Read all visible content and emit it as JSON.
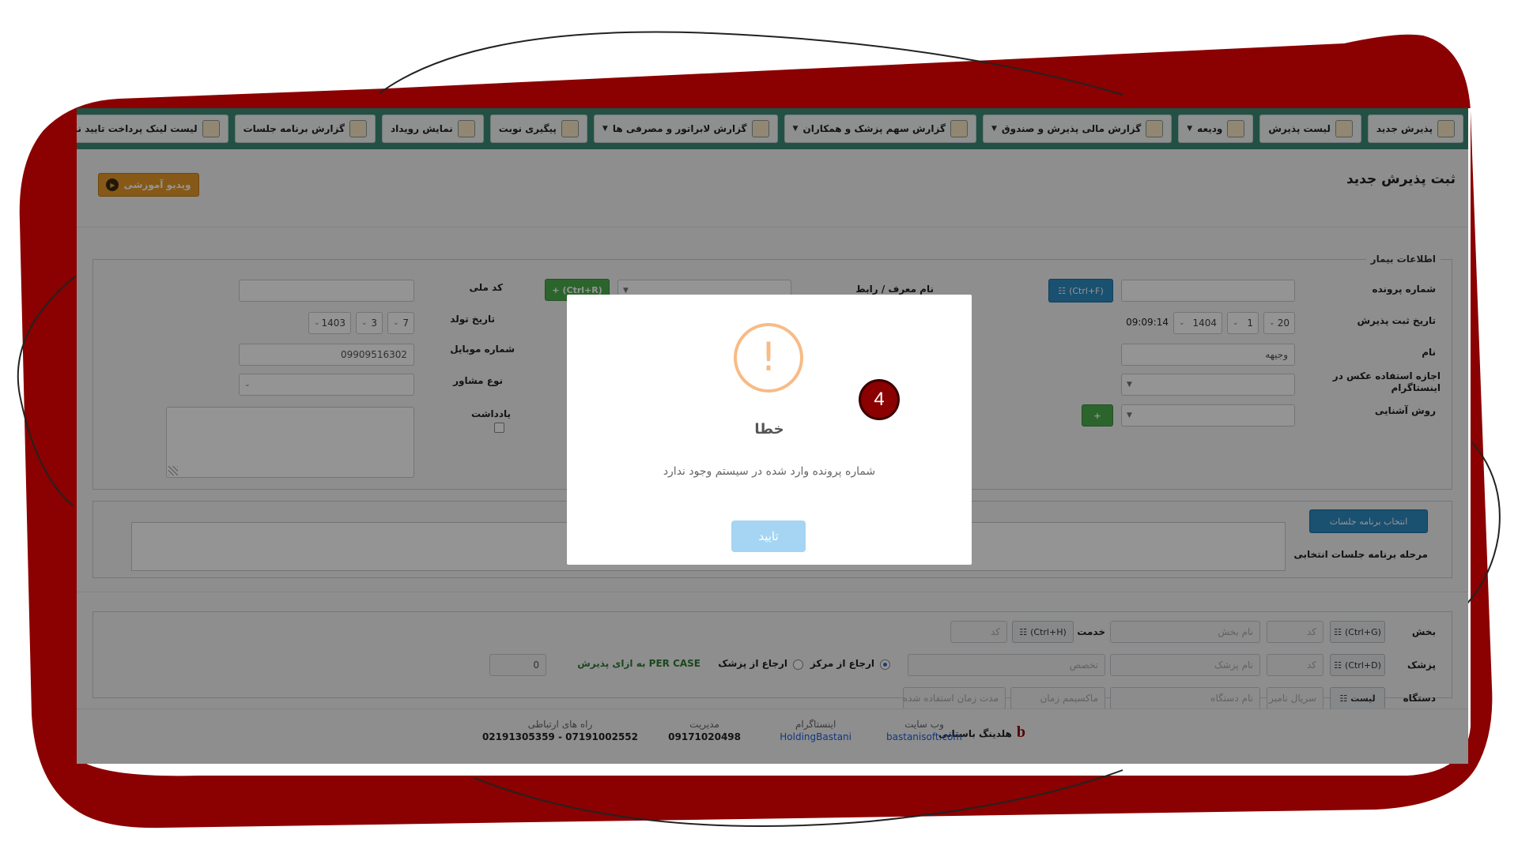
{
  "colors": {
    "frame": "#8b0000",
    "nav": "#3b8a78",
    "accent_blue": "#2d8bc1",
    "green": "#4cae4c",
    "warning": "#f8bb86",
    "confirm": "#a5d5f2"
  },
  "nav": {
    "items": [
      {
        "label": "پذیرش جدید",
        "icon": "user-add-icon",
        "dropdown": false
      },
      {
        "label": "لیست پذیرش",
        "icon": "list-doc-icon",
        "dropdown": false
      },
      {
        "label": "ودیعه",
        "icon": "deposit-icon",
        "dropdown": true
      },
      {
        "label": "گزارش مالی پذیرش و صندوق",
        "icon": "finance-report-icon",
        "dropdown": true
      },
      {
        "label": "گزارش سهم پزشک و همکاران",
        "icon": "doctor-share-icon",
        "dropdown": true
      },
      {
        "label": "گزارش لابراتور و مصرفی ها",
        "icon": "lab-report-icon",
        "dropdown": true
      },
      {
        "label": "پیگیری نوبت",
        "icon": "followup-icon",
        "dropdown": false
      },
      {
        "label": "نمایش رویداد",
        "icon": "calendar-icon",
        "dropdown": false
      },
      {
        "label": "گزارش برنامه جلسات",
        "icon": "sessions-icon",
        "dropdown": false
      },
      {
        "label": "لیست لینک پرداخت تایید نشده",
        "icon": "payment-link-icon",
        "dropdown": false
      }
    ]
  },
  "page": {
    "title": "ثبت پذیرش جدید",
    "video_button": "ویدیو آموزشی"
  },
  "patient": {
    "legend": "اطلاعات بیمار",
    "file_number_label": "شماره پرونده",
    "file_number_shortcut": "(Ctrl+F)",
    "referrer_label": "نام معرف / رابط",
    "referrer_add": "(Ctrl+R)",
    "national_code_label": "کد ملی",
    "admission_date_label": "تاریخ ثبت پذیرش",
    "admission_day": "20",
    "admission_month": "1",
    "admission_year": "1404",
    "admission_time": "09:09:14",
    "birth_date_label": "تاریخ تولد",
    "birth_day": "7",
    "birth_month": "3",
    "birth_year": "1403",
    "name_label": "نام",
    "name_value": "وجیهه",
    "mobile_label": "شماره موبایل",
    "mobile_value": "09909516302",
    "instagram_permission_label": "اجازه استفاده عکس در اینستاگرام",
    "advisor_type_label": "نوع مشاور",
    "acquaintance_label": "روش آشنایی",
    "note_label": "یادداشت"
  },
  "sessions": {
    "button": "انتخاب برنامه جلسات",
    "stage_label": "مرحله برنامه جلسات انتخابی"
  },
  "services": {
    "department_label": "بخش",
    "department_shortcut": "(Ctrl+G)",
    "code_placeholder": "کد",
    "department_name_placeholder": "نام بخش",
    "service_label": "خدمت",
    "service_shortcut": "(Ctrl+H)",
    "doctor_label": "پزشک",
    "doctor_shortcut": "(Ctrl+D)",
    "doctor_name_placeholder": "نام پزشک",
    "specialty_placeholder": "تخصص",
    "referral_center": "ارجاع از مرکز",
    "referral_doctor": "ارجاع از پزشک",
    "per_case": "PER CASE به ازای پذیرش",
    "per_case_value": "0",
    "device_label": "دستگاه",
    "device_list_button": "لیست",
    "serial_placeholder": "سریال نامبر",
    "device_name_placeholder": "نام دستگاه",
    "max_time_placeholder": "ماکسیمم زمان",
    "used_time_placeholder": "مدت زمان استفاده شده"
  },
  "footer": {
    "brand": "هلدینگ باستانی",
    "website_label": "وب سایت",
    "website_value": "bastanisoft.com",
    "instagram_label": "اینستاگرام",
    "instagram_value": "HoldingBastani",
    "management_label": "مدیریت",
    "management_value": "09171020498",
    "contact_label": "راه های ارتباطی",
    "contact_value": "07191002552 - 02191305359"
  },
  "modal": {
    "title": "خطا",
    "message": "شماره پرونده وارد شده در سیستم وجود ندارد",
    "confirm": "تایید",
    "icon": "exclamation-icon"
  },
  "step_badge": "4"
}
